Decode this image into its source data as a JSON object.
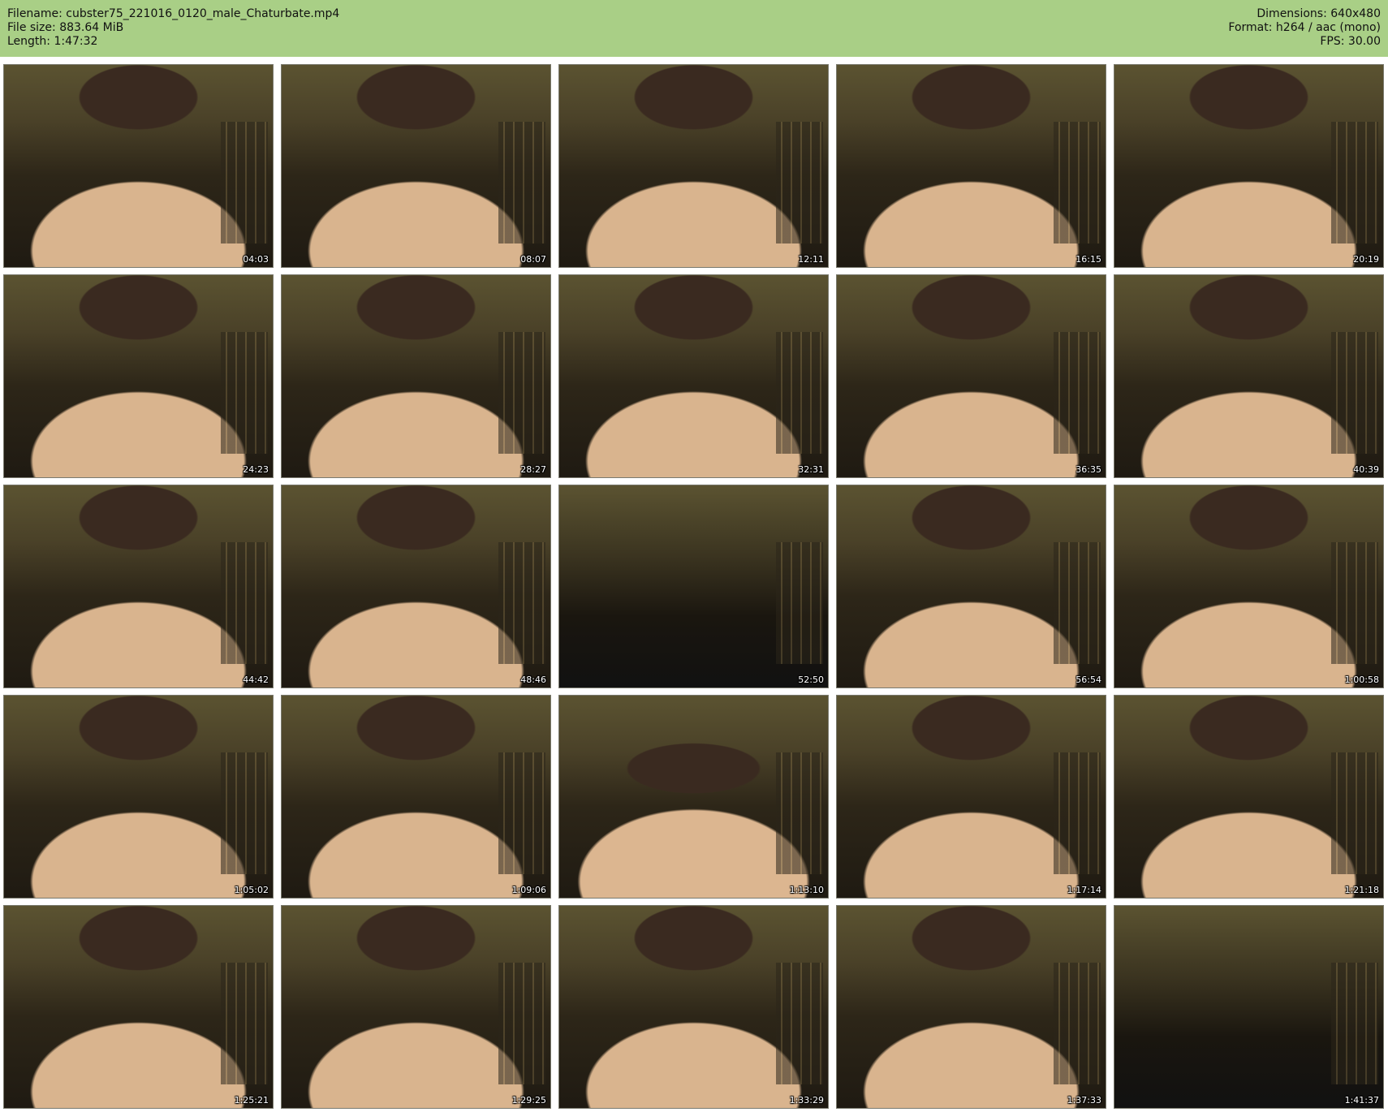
{
  "header": {
    "filename_line": "Filename: cubster75_221016_0120_male_Chaturbate.mp4",
    "filesize_line": "File size: 883.64 MiB",
    "length_line": "Length: 1:47:32",
    "dimensions_line": "Dimensions: 640x480",
    "format_line": "Format: h264 / aac (mono)",
    "fps_line": "FPS: 30.00"
  },
  "thumbnails": [
    {
      "timestamp": "04:03"
    },
    {
      "timestamp": "08:07"
    },
    {
      "timestamp": "12:11"
    },
    {
      "timestamp": "16:15"
    },
    {
      "timestamp": "20:19"
    },
    {
      "timestamp": "24:23"
    },
    {
      "timestamp": "28:27"
    },
    {
      "timestamp": "32:31"
    },
    {
      "timestamp": "36:35"
    },
    {
      "timestamp": "40:39"
    },
    {
      "timestamp": "44:42"
    },
    {
      "timestamp": "48:46"
    },
    {
      "timestamp": "52:50"
    },
    {
      "timestamp": "56:54"
    },
    {
      "timestamp": "1:00:58"
    },
    {
      "timestamp": "1:05:02"
    },
    {
      "timestamp": "1:09:06"
    },
    {
      "timestamp": "1:13:10"
    },
    {
      "timestamp": "1:17:14"
    },
    {
      "timestamp": "1:21:18"
    },
    {
      "timestamp": "1:25:21"
    },
    {
      "timestamp": "1:29:25"
    },
    {
      "timestamp": "1:33:29"
    },
    {
      "timestamp": "1:37:33"
    },
    {
      "timestamp": "1:41:37"
    }
  ],
  "colors": {
    "header_bg": "#a9cf86",
    "page_bg": "#ffffff"
  }
}
